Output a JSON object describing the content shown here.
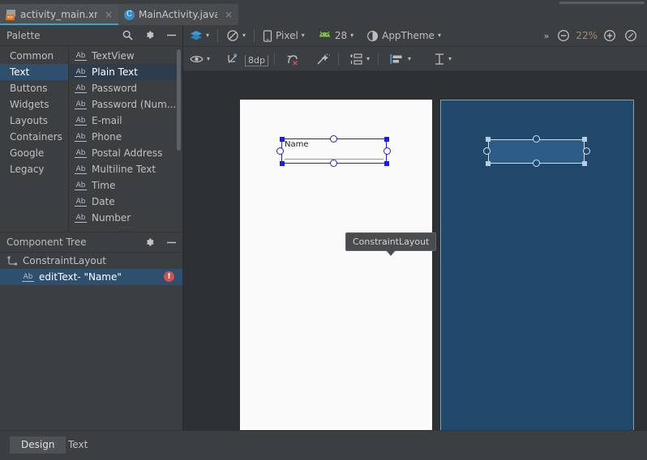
{
  "window": {
    "editor_tabs": [
      {
        "label": "activity_main.xml",
        "icon": "xml-layout-icon",
        "close": "×",
        "active": true
      },
      {
        "label": "MainActivity.java",
        "icon": "java-class-icon",
        "close": "×",
        "active": false
      }
    ]
  },
  "palette": {
    "title": "Palette",
    "tools": [
      {
        "name": "search-icon",
        "label": ""
      },
      {
        "name": "gear-icon",
        "label": ""
      },
      {
        "name": "minimize-icon",
        "label": ""
      }
    ],
    "categories": [
      {
        "label": "Common",
        "selected": false
      },
      {
        "label": "Text",
        "selected": true
      },
      {
        "label": "Buttons",
        "selected": false
      },
      {
        "label": "Widgets",
        "selected": false
      },
      {
        "label": "Layouts",
        "selected": false
      },
      {
        "label": "Containers",
        "selected": false
      },
      {
        "label": "Google",
        "selected": false
      },
      {
        "label": "Legacy",
        "selected": false
      }
    ],
    "items": [
      {
        "label": "TextView",
        "icon": "Ab",
        "selected": false
      },
      {
        "label": "Plain Text",
        "icon": "Ab",
        "selected": true
      },
      {
        "label": "Password",
        "icon": "Ab",
        "selected": false
      },
      {
        "label": "Password (Num...",
        "icon": "Ab",
        "selected": false
      },
      {
        "label": "E-mail",
        "icon": "Ab",
        "selected": false
      },
      {
        "label": "Phone",
        "icon": "Ab",
        "selected": false
      },
      {
        "label": "Postal Address",
        "icon": "Ab",
        "selected": false
      },
      {
        "label": "Multiline Text",
        "icon": "Ab",
        "selected": false
      },
      {
        "label": "Time",
        "icon": "Ab",
        "selected": false
      },
      {
        "label": "Date",
        "icon": "Ab",
        "selected": false
      },
      {
        "label": "Number",
        "icon": "Ab",
        "selected": false
      }
    ],
    "grip": "·····"
  },
  "component_tree": {
    "title": "Component Tree",
    "tools": [
      {
        "name": "gear-icon"
      },
      {
        "name": "minimize-icon"
      }
    ],
    "nodes": [
      {
        "label": "ConstraintLayout",
        "icon": "constraint-layout-icon",
        "selected": false,
        "error": false
      },
      {
        "label": "editText- \"Name\"",
        "icon": "Ab",
        "selected": true,
        "error": true,
        "error_glyph": "!"
      }
    ]
  },
  "toolbar_main": {
    "design_surface": {
      "label": "",
      "name": "design-surface-select",
      "caret": "▾"
    },
    "orientation": {
      "label": "",
      "name": "orientation-select",
      "caret": "▾"
    },
    "device": {
      "label": "Pixel",
      "name": "device-select",
      "caret": "▾"
    },
    "api": {
      "label": "28",
      "name": "api-level-select",
      "caret": "▾"
    },
    "theme": {
      "label": "AppTheme",
      "name": "theme-select",
      "caret": "▾"
    },
    "overflow": "»",
    "zoom_out": "−",
    "zoom_level": "22%",
    "zoom_in": "+",
    "zoom_fit": ""
  },
  "toolbar_design": {
    "view_options": {
      "name": "eye-icon",
      "caret": "▾"
    },
    "clear_constraints": {
      "name": "clear-constraints-icon"
    },
    "default_margin": {
      "label": "8dp",
      "name": "default-margin-field"
    },
    "infer_constraints_off": {
      "name": "constraint-error-icon"
    },
    "magic_constraints": {
      "name": "auto-connect-icon"
    },
    "guidelines": {
      "name": "guidelines-icon",
      "caret": "▾"
    },
    "align": {
      "name": "align-icon",
      "caret": "▾"
    },
    "margins": {
      "name": "margin-icon",
      "caret": "▾"
    }
  },
  "canvas": {
    "tooltip": "ConstraintLayout",
    "widget": {
      "text": "Name",
      "name": "edittext-widget"
    },
    "blueprint_widget": {
      "name": "edittext-blueprint-widget"
    }
  },
  "bottom_tabs": [
    {
      "label": "Design",
      "selected": true
    },
    {
      "label": "Text",
      "selected": false
    }
  ],
  "colors": {
    "accent_tab": "#3ba7c4",
    "selection_blue": "#2f4f6f",
    "error_red": "#c75450",
    "blueprint_bg": "#22496b",
    "handle_blue": "#1a1aff"
  }
}
